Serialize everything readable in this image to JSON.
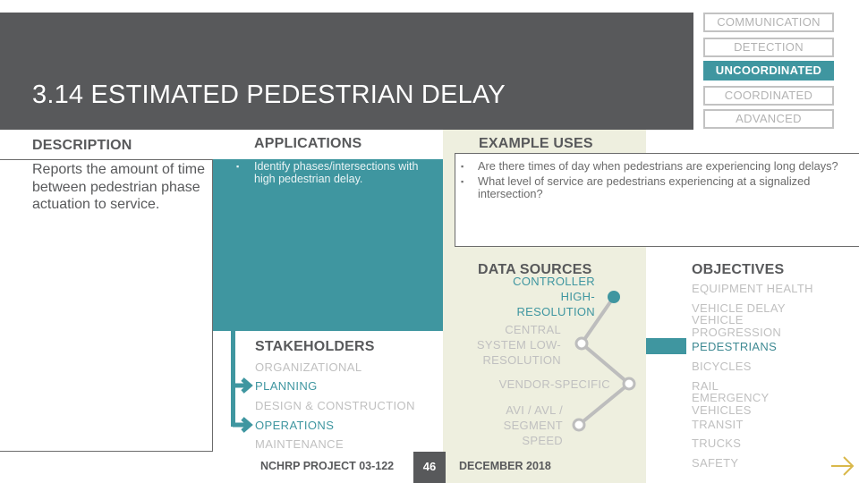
{
  "header": {
    "title": "3.14 ESTIMATED PEDESTRIAN DELAY"
  },
  "levels": [
    {
      "label": "COMMUNICATION",
      "active": false
    },
    {
      "label": "DETECTION",
      "active": false
    },
    {
      "label": "UNCOORDINATED",
      "active": true
    },
    {
      "label": "COORDINATED",
      "active": false
    },
    {
      "label": "ADVANCED",
      "active": false
    }
  ],
  "description": {
    "heading": "DESCRIPTION",
    "text": "Reports the amount of time between pedestrian phase actuation to service."
  },
  "applications": {
    "heading": "APPLICATIONS",
    "items": [
      "Identify phases/intersections with high pedestrian delay."
    ]
  },
  "example_uses": {
    "heading": "EXAMPLE USES",
    "items": [
      "Are there times of day when pedestrians are experiencing long delays?",
      "What level of service are pedestrians experiencing at a signalized intersection?"
    ]
  },
  "stakeholders": {
    "heading": "STAKEHOLDERS",
    "items": [
      {
        "label": "ORGANIZATIONAL",
        "selected": false
      },
      {
        "label": "PLANNING",
        "selected": true
      },
      {
        "label": "DESIGN & CONSTRUCTION",
        "selected": false
      },
      {
        "label": "OPERATIONS",
        "selected": true
      },
      {
        "label": "MAINTENANCE",
        "selected": false
      }
    ]
  },
  "data_sources": {
    "heading": "DATA SOURCES",
    "items": [
      {
        "label": "CONTROLLER HIGH-RESOLUTION",
        "selected": true
      },
      {
        "label": "CENTRAL SYSTEM LOW-RESOLUTION",
        "selected": false
      },
      {
        "label": "VENDOR-SPECIFIC",
        "selected": false
      },
      {
        "label": "AVI / AVL / SEGMENT SPEED",
        "selected": false
      }
    ]
  },
  "objectives": {
    "heading": "OBJECTIVES",
    "items": [
      {
        "label": "EQUIPMENT HEALTH",
        "selected": false
      },
      {
        "label": "VEHICLE DELAY",
        "selected": false
      },
      {
        "label": "VEHICLE PROGRESSION",
        "selected": false
      },
      {
        "label": "PEDESTRIANS",
        "selected": true
      },
      {
        "label": "BICYCLES",
        "selected": false
      },
      {
        "label": "RAIL",
        "selected": false
      },
      {
        "label": "EMERGENCY VEHICLES",
        "selected": false
      },
      {
        "label": "TRANSIT",
        "selected": false
      },
      {
        "label": "TRUCKS",
        "selected": false
      },
      {
        "label": "SAFETY",
        "selected": false
      }
    ]
  },
  "footer": {
    "project": "NCHRP PROJECT 03-122",
    "page_number": "46",
    "date": "DECEMBER 2018"
  },
  "colors": {
    "accent_teal": "#3f96a0",
    "dark_gray": "#58595b",
    "beige_panel": "#eeefdf",
    "inactive_gray": "#c0c0c0",
    "next_arrow_gold": "#d9b84a"
  }
}
